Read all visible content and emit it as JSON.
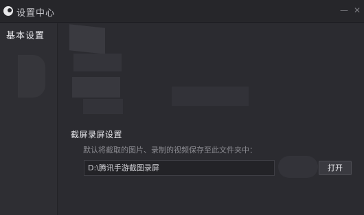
{
  "window": {
    "title": "设置中心",
    "minimize_glyph": "—",
    "close_glyph": "✕"
  },
  "sidebar": {
    "items": [
      {
        "label": "基本设置",
        "selected": true
      }
    ]
  },
  "main": {
    "screenshot_section": {
      "title": "截屏录屏设置",
      "description": "默认将截取的图片、录制的视频保存至此文件夹中：",
      "path_value": "D:\\腾讯手游截图录屏",
      "open_button_label": "打开"
    }
  },
  "colors": {
    "background": "#2b2b30",
    "sidebar": "#2e2e33",
    "titlebar": "#26262a",
    "text_primary": "#e6e6ea",
    "text_secondary": "#8c8c92"
  }
}
